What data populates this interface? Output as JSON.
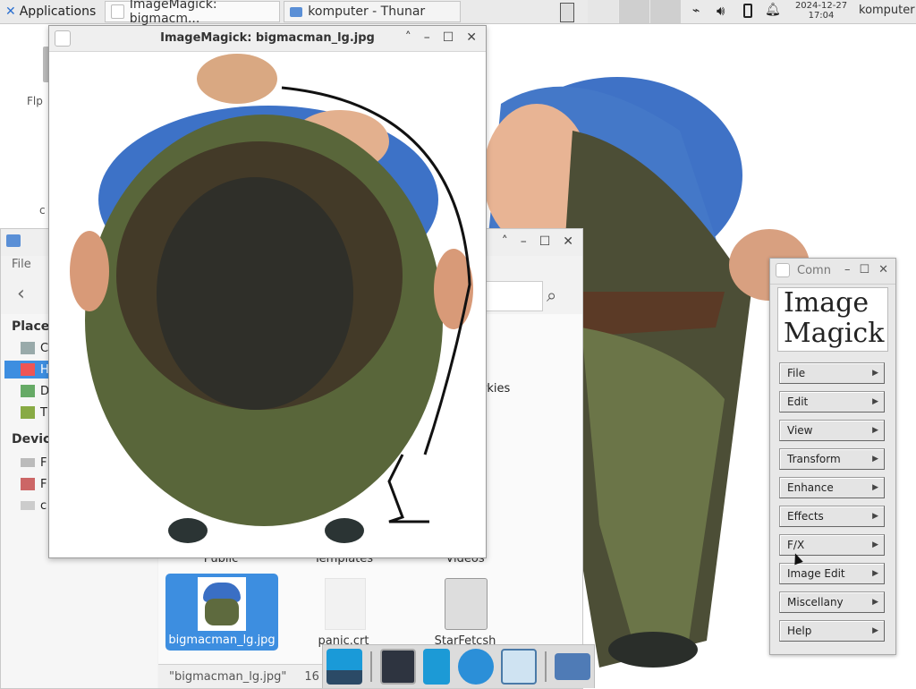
{
  "panel": {
    "applications_label": "Applications",
    "tasks": [
      {
        "label": "ImageMagick: bigmacm..."
      },
      {
        "label": "komputer - Thunar"
      }
    ],
    "clock_date": "2024-12-27",
    "clock_time": "17:04",
    "user": "komputer"
  },
  "desktop": {
    "icon_label_1": "Flp",
    "icon_label_2": "c"
  },
  "thunar": {
    "menu_file": "File",
    "sidebar": {
      "places_header": "Places",
      "devices_header": "Devic",
      "places": [
        "C",
        "H",
        "D",
        "T"
      ],
      "devices": [
        "F",
        "F",
        "c"
      ]
    },
    "files": {
      "public": "Public",
      "templates": "Templates",
      "videos": "Videos",
      "bookmarks": "rkies",
      "selected": "bigmacman_lg.jpg",
      "panic": "panic.crt",
      "starfetch": "StarFetcsh"
    },
    "status_text": "\"bigmacman_lg.jpg\"",
    "status_size": "16"
  },
  "imagemagick": {
    "title": "ImageMagick: bigmacman_lg.jpg"
  },
  "command": {
    "title": "Comn",
    "logo_line1": "Image",
    "logo_line2": "Magick",
    "buttons": [
      "File",
      "Edit",
      "View",
      "Transform",
      "Enhance",
      "Effects",
      "F/X",
      "Image Edit",
      "Miscellany",
      "Help"
    ]
  },
  "colors": {
    "selection": "#3d8ee0",
    "shirt_blue": "#3a6fc4",
    "pants_green": "#5e6a3e"
  }
}
